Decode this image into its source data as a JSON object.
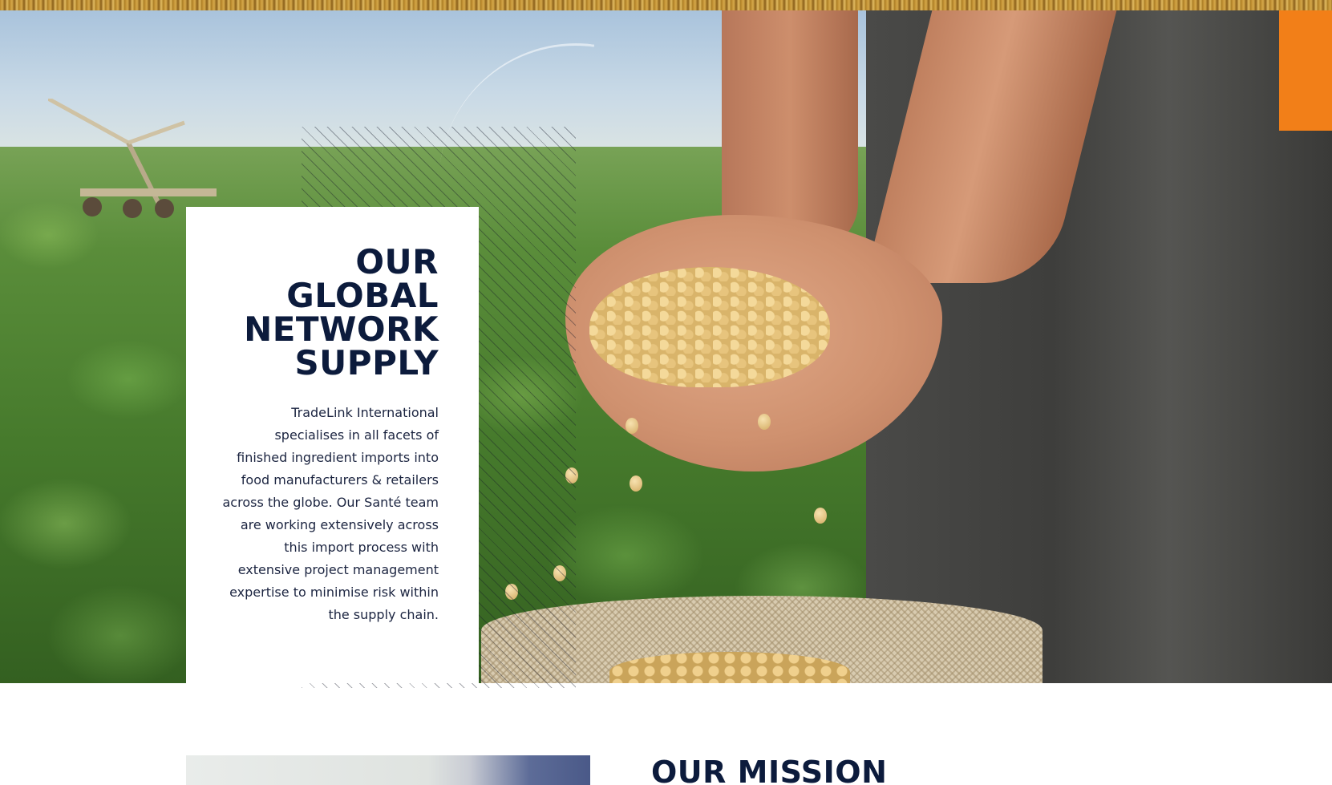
{
  "hero": {
    "title_lines": [
      "OUR",
      "GLOBAL",
      "NETWORK",
      "SUPPLY"
    ],
    "description": "TradeLink International specialises in all facets of finished ingredient imports into food manufacturers & retailers across the globe. Our Santé team are working extensively across this import process with extensive project management expertise to minimise risk within the supply chain."
  },
  "mission": {
    "title": "OUR MISSION"
  },
  "colors": {
    "heading": "#0c1b3c",
    "body_text": "#1b2440",
    "card_background": "#ffffff",
    "vest_orange": "#f27f18"
  }
}
